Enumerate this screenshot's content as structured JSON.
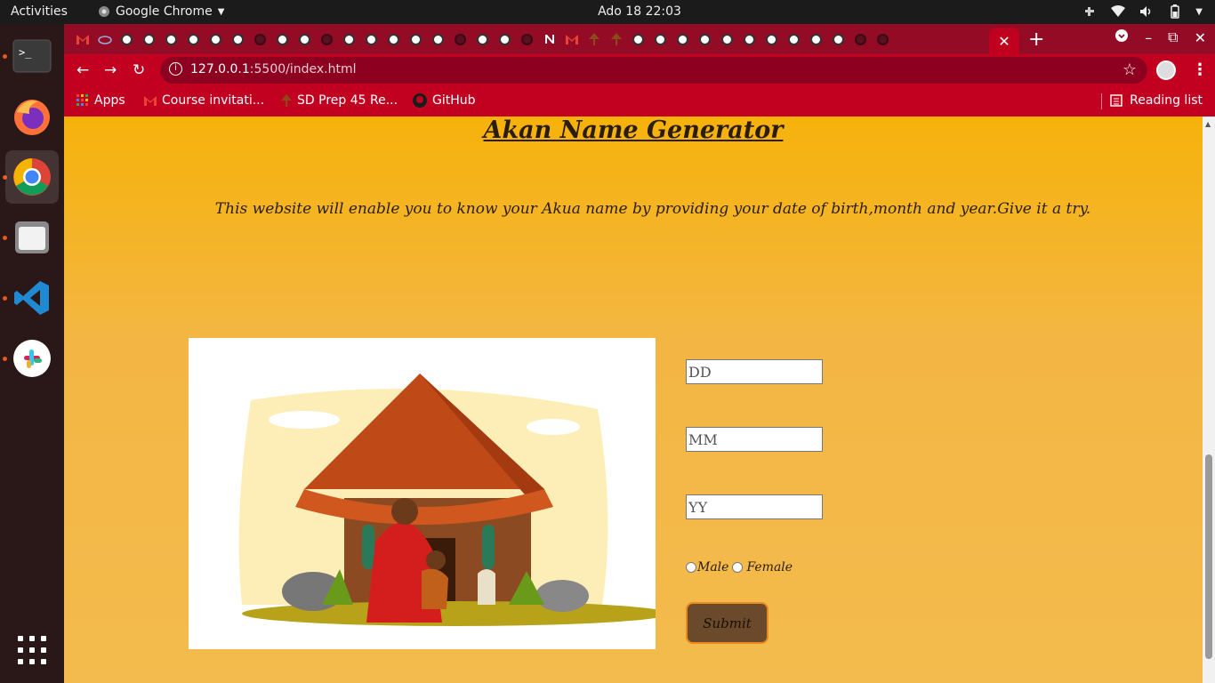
{
  "topbar": {
    "activities": "Activities",
    "app_name": "Google Chrome",
    "clock": "Ado 18  22:03"
  },
  "browser": {
    "url_host": "127.0.0.1",
    "url_rest": ":5500/index.html",
    "bookmarks": {
      "apps": "Apps",
      "item1": "Course invitati...",
      "item2": "SD Prep 45 Re...",
      "item3": "GitHub",
      "reading_list": "Reading list"
    }
  },
  "page": {
    "title": "Akan Name Generator",
    "intro": "This website will enable you to know your Akua name by providing your date of birth,month and year.Give it a try.",
    "form": {
      "day_placeholder": "DD",
      "month_placeholder": "MM",
      "year_placeholder": "YY",
      "male_label": "Male",
      "female_label": "Female",
      "submit_label": "Submit"
    }
  },
  "colors": {
    "tab_strip": "#930b25",
    "toolbar": "#c20020",
    "page_bg": "#f3b644",
    "submit_bg": "#6b4a2b",
    "submit_border": "#e88a1c"
  }
}
